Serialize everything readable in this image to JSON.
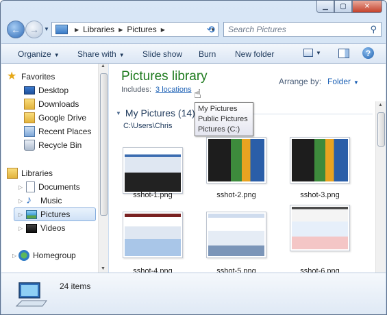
{
  "window": {
    "caption": {
      "minimize": "▁",
      "maximize": "▢",
      "close": "✕"
    }
  },
  "address_bar": {
    "breadcrumbs": [
      "Libraries",
      "Pictures"
    ],
    "search_placeholder": "Search Pictures"
  },
  "toolbar": {
    "organize": "Organize",
    "share_with": "Share with",
    "slide_show": "Slide show",
    "burn": "Burn",
    "new_folder": "New folder"
  },
  "nav_pane": {
    "favorites_label": "Favorites",
    "favorites": [
      {
        "label": "Desktop",
        "icon": "desktop-icon"
      },
      {
        "label": "Downloads",
        "icon": "downloads-folder-icon"
      },
      {
        "label": "Google Drive",
        "icon": "google-drive-folder-icon"
      },
      {
        "label": "Recent Places",
        "icon": "recent-places-icon"
      },
      {
        "label": "Recycle Bin",
        "icon": "recycle-bin-icon"
      }
    ],
    "libraries_label": "Libraries",
    "libraries": [
      {
        "label": "Documents",
        "icon": "documents-library-icon"
      },
      {
        "label": "Music",
        "icon": "music-library-icon"
      },
      {
        "label": "Pictures",
        "icon": "pictures-library-icon",
        "selected": true
      },
      {
        "label": "Videos",
        "icon": "videos-library-icon"
      }
    ],
    "homegroup_label": "Homegroup"
  },
  "content": {
    "library_title": "Pictures library",
    "includes_label": "Includes:",
    "includes_link": "3 locations",
    "arrange_by_label": "Arrange by:",
    "arrange_by_value": "Folder",
    "group_title": "My Pictures (14)",
    "group_path": "C:\\Users\\Chris",
    "tooltip_lines": [
      "My Pictures",
      "Public Pictures",
      "Pictures (C:)"
    ],
    "files": [
      "sshot-1.png",
      "sshot-2.png",
      "sshot-3.png",
      "sshot-4.png",
      "sshot-5.png",
      "sshot-6.png"
    ]
  },
  "details": {
    "item_count": "24 items"
  },
  "colors": {
    "library_title": "#1d7a1d",
    "link": "#1a5fb4",
    "selection": "#cfe1f6"
  }
}
